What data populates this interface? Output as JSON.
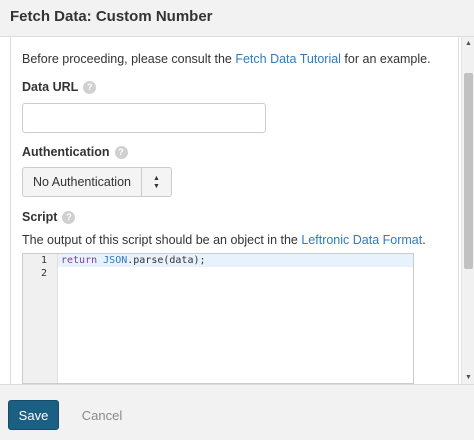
{
  "dialog": {
    "title": "Fetch Data: Custom Number"
  },
  "intro": {
    "before": "Before proceeding, please consult the ",
    "link": "Fetch Data Tutorial",
    "after": " for an example."
  },
  "data_url": {
    "label": "Data URL",
    "value": "",
    "placeholder": ""
  },
  "authentication": {
    "label": "Authentication",
    "selected": "No Authentication"
  },
  "script": {
    "label": "Script",
    "desc_before": "The output of this script should be an object in the ",
    "desc_link": "Leftronic Data Format",
    "desc_after": ".",
    "line_numbers": [
      "1",
      "2"
    ],
    "code_keyword": "return",
    "code_space": " ",
    "code_object": "JSON",
    "code_rest": ".parse(data);"
  },
  "help_icon_glyph": "?",
  "footer": {
    "save_label": "Save",
    "cancel_label": "Cancel"
  },
  "colors": {
    "accent": "#1b5f82",
    "link": "#2f7ac0",
    "header_bg": "#f2f2f2"
  }
}
